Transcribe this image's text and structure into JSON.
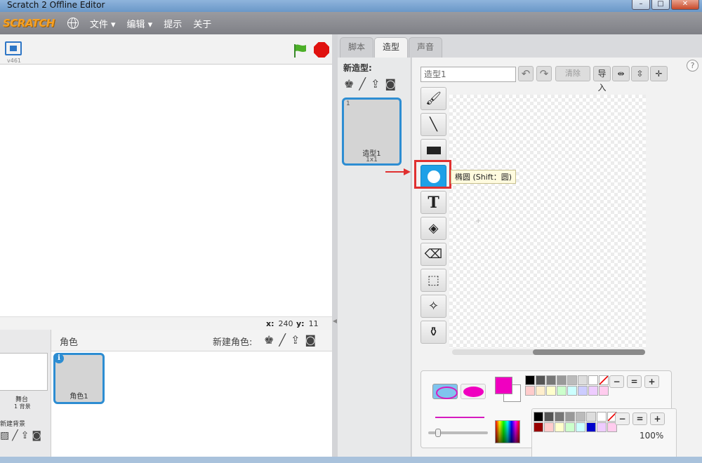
{
  "window": {
    "title": "Scratch 2 Offline Editor",
    "minimize": "–",
    "maximize": "□",
    "close": "✕"
  },
  "menubar": {
    "logo": "SCRATCH",
    "items": [
      "文件 ▾",
      "编辑 ▾",
      "提示",
      "关于"
    ]
  },
  "stage": {
    "version": "v461",
    "x_label": "x:",
    "x_value": "240",
    "y_label": "y:",
    "y_value": "11"
  },
  "sprites": {
    "title": "角色",
    "new_sprite_label": "新建角色:",
    "stage_label": "舞台",
    "stage_sub": "1 背景",
    "new_backdrop_label": "新建背景",
    "list": [
      {
        "name": "角色1"
      }
    ]
  },
  "tabs": [
    "脚本",
    "造型",
    "声音"
  ],
  "active_tab": "造型",
  "costumes": {
    "new_label": "新造型:",
    "list": [
      {
        "num": "1",
        "name": "造型1",
        "size": "1x1"
      }
    ]
  },
  "editor": {
    "costume_name": "造型1",
    "clear_label": "清除",
    "import_label": "导入",
    "tools": [
      "brush-tool",
      "line-tool",
      "rectangle-tool",
      "ellipse-tool",
      "text-tool",
      "fill-tool",
      "eraser-tool",
      "select-tool",
      "reshape-tool",
      "stamp-tool"
    ],
    "selected_tool": "ellipse-tool",
    "tooltip": "椭圆 (Shift：圆)",
    "primary_color": "#f000c0",
    "secondary_color": "#ffffff",
    "zoom": "100%"
  },
  "colors": {
    "accent": "#2d8dd2",
    "selected_tool": "#1ea0e7",
    "highlight": "#e03030"
  }
}
